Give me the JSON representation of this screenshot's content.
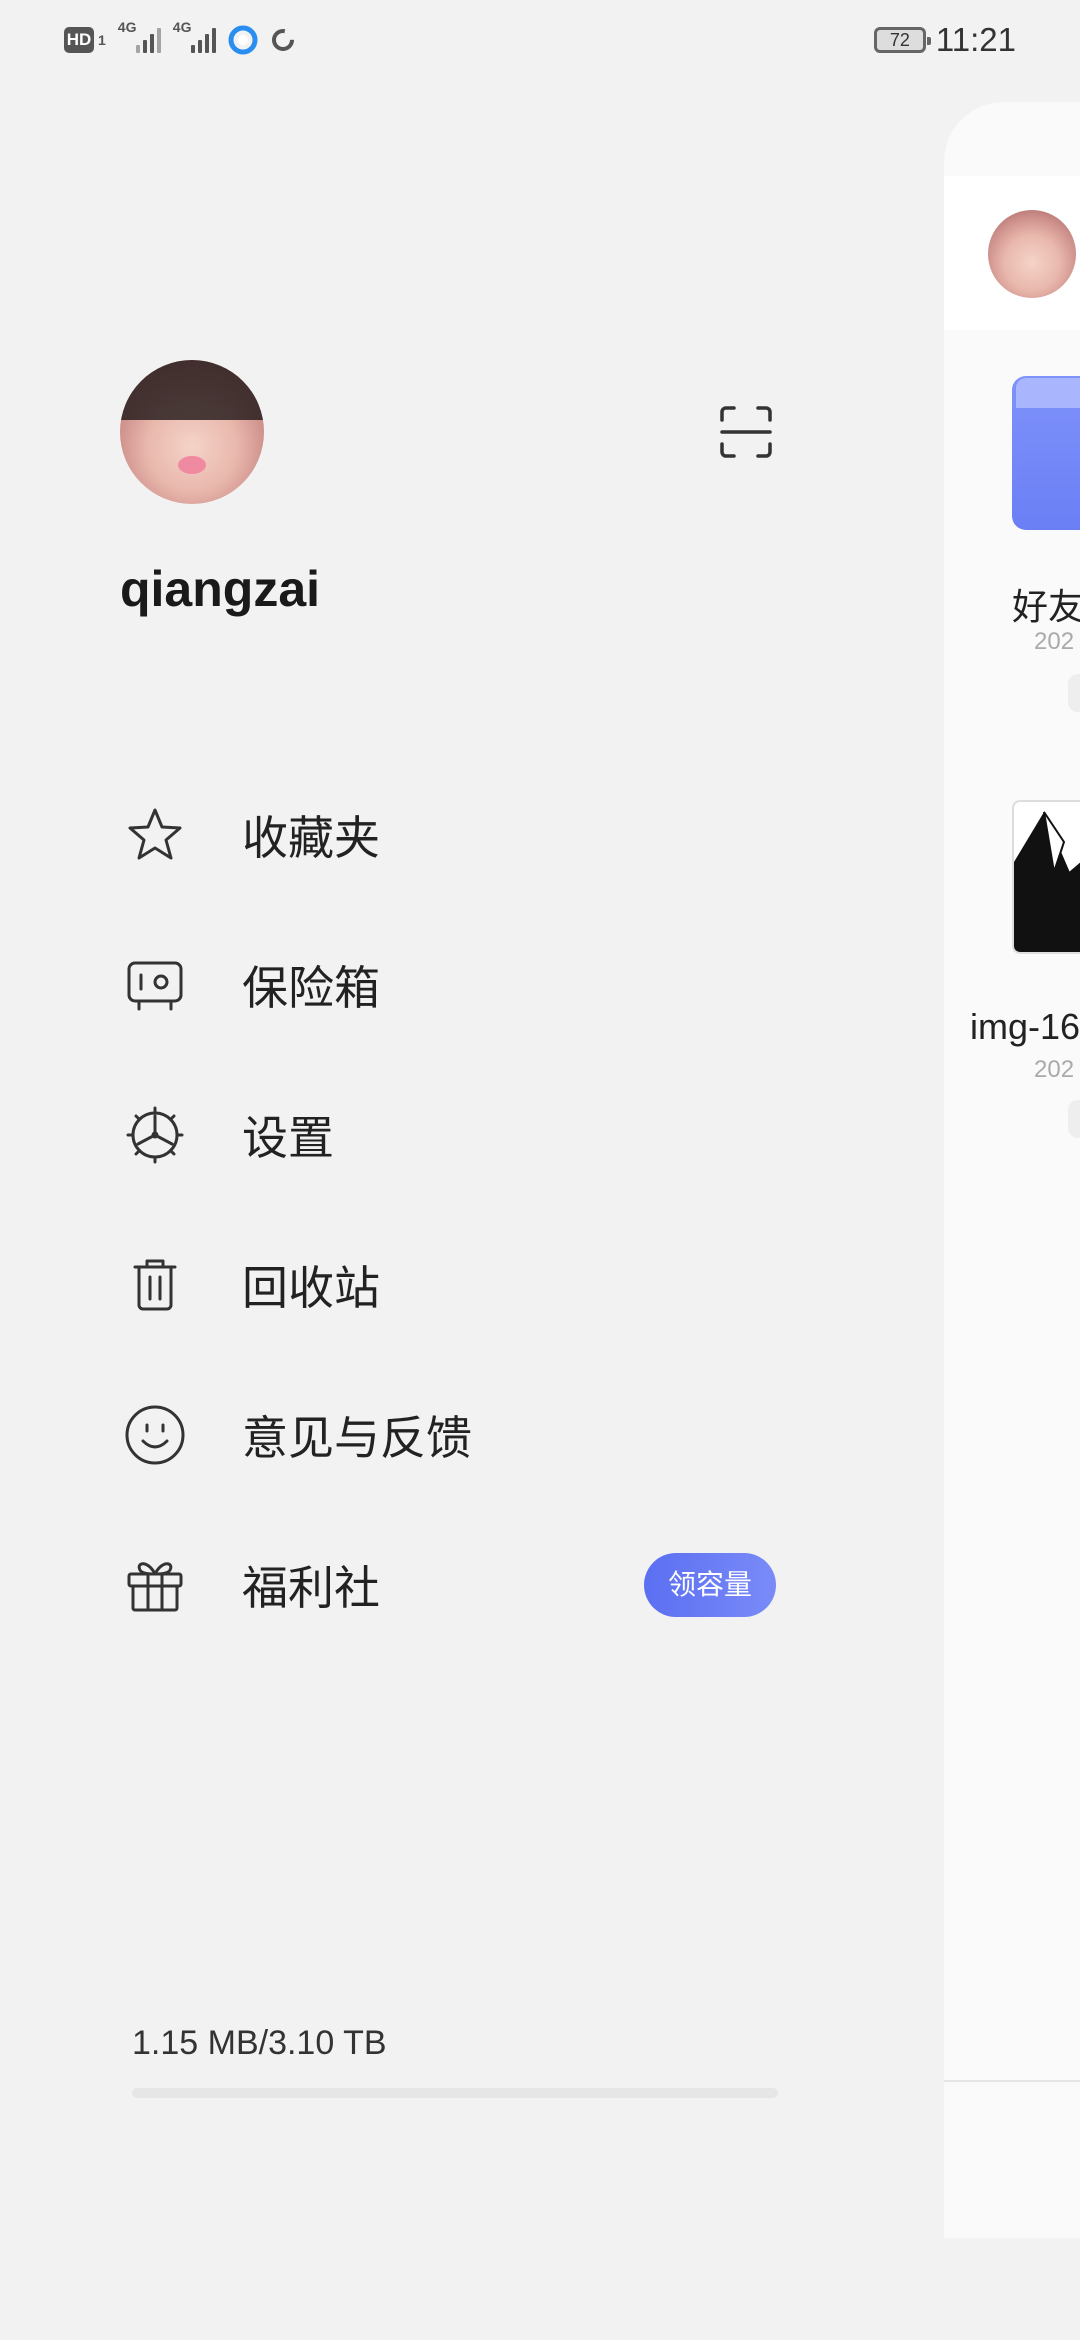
{
  "status_bar": {
    "hd": "HD",
    "sim_index": "1",
    "net1": "4G",
    "net2": "4G",
    "battery_level": "72",
    "time": "11:21"
  },
  "drawer": {
    "username": "qiangzai",
    "menu": [
      {
        "label": "收藏夹",
        "icon": "star-icon"
      },
      {
        "label": "保险箱",
        "icon": "safe-icon"
      },
      {
        "label": "设置",
        "icon": "settings-icon"
      },
      {
        "label": "回收站",
        "icon": "trash-icon"
      },
      {
        "label": "意见与反馈",
        "icon": "smile-icon"
      },
      {
        "label": "福利社",
        "icon": "gift-icon",
        "badge": "领容量"
      }
    ],
    "storage": {
      "text": "1.15 MB/3.10 TB",
      "used_fraction": 0.0
    }
  },
  "main_peek": {
    "item1_name": "好友",
    "item1_date": "202",
    "item2_name": "img-16",
    "item2_date": "202"
  },
  "colors": {
    "accent": "#5b6ff2",
    "background": "#f2f2f2"
  }
}
